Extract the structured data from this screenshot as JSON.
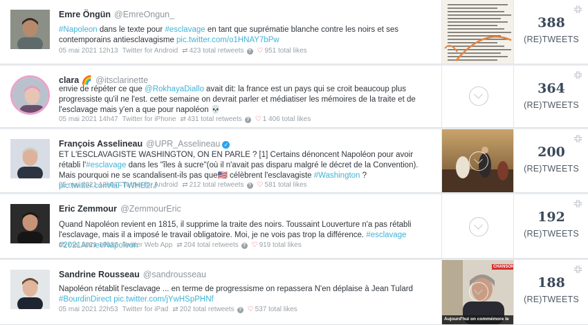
{
  "colors": {
    "link": "#3fb3d6",
    "heart": "#e0415a",
    "verified": "#2aa3ef"
  },
  "retweet_label": "(RE)TWEETS",
  "tweets": [
    {
      "name": "Emre Öngün",
      "handle": "@EmreOngun_",
      "body": [
        {
          "t": "#Napoleon",
          "h": true
        },
        {
          "t": " dans le texte pour ",
          "h": false
        },
        {
          "t": "#esclavage",
          "h": true
        },
        {
          "t": " en tant que suprématie blanche contre les noirs et ses contemporains antiesclavagisme ",
          "h": false
        },
        {
          "t": "pic.twitter.com/o1HNAY7bPw",
          "h": true
        }
      ],
      "date": "05 mai 2021 12h13",
      "source": "Twitter for Android",
      "retweets": "423 total retweets",
      "likes": "951 total likes",
      "count": "388",
      "media": "document-scan"
    },
    {
      "name": "clara 🌈",
      "handle": "@itsclarinette",
      "body": [
        {
          "t": "envie de répéter ce que ",
          "h": false
        },
        {
          "t": "@RokhayaDiallo",
          "h": true
        },
        {
          "t": " avait dit: la france est un pays qui se croit beaucoup plus progressiste qu'il ne l'est. cette semaine on devrait parler et médiatiser les mémoires de la traite et de l'esclavage mais y'en a que pour napoléon 💀",
          "h": false
        }
      ],
      "date": "05 mai 2021 14h47",
      "source": "Twitter for iPhone",
      "retweets": "431 total retweets",
      "likes": "1 406 total likes",
      "count": "364",
      "media": "none"
    },
    {
      "name": "François Asselineau",
      "handle": "@UPR_Asselineau",
      "verified": true,
      "body": [
        {
          "t": "ET L'ESCLAVAGISTE WASHINGTON, ON EN PARLE ? [1] Certains dénoncent Napoléon pour avoir rétabli l'",
          "h": false
        },
        {
          "t": "#esclavage",
          "h": true
        },
        {
          "t": " dans les \"îles à sucre\"(où il n'avait pas disparu malgré le décret de la Convention). Mais pourquoi ne se scandalisent-ils pas que🇺🇸 célèbrent l'esclavagiste ",
          "h": false
        },
        {
          "t": "#Washington",
          "h": true
        },
        {
          "t": " ? ",
          "h": false
        },
        {
          "t": "pic.twitter.com/laFTWHB2rJ",
          "h": true
        }
      ],
      "date": "05 mai 2021 12h07",
      "source": "Twitter for Android",
      "retweets": "212 total retweets",
      "likes": "581 total likes",
      "count": "200",
      "media": "painting"
    },
    {
      "name": "Eric Zemmour",
      "handle": "@ZemmourEric",
      "body": [
        {
          "t": "Quand Napoléon revient en 1815, il supprime la traite des noirs. Toussaint Louverture n'a pas rétabli l'esclavage, mais il a imposé le travail obligatoire. Moi, je ne vois pas trop la différence. ",
          "h": false
        },
        {
          "t": "#esclavage",
          "h": true
        },
        {
          "t": " ",
          "h": false
        },
        {
          "t": "#2021AnneeNapoleon",
          "h": true
        }
      ],
      "date": "05 mai 2021 19h37",
      "source": "Twitter Web App",
      "retweets": "204 total retweets",
      "likes": "919 total likes",
      "count": "192",
      "media": "none"
    },
    {
      "name": "Sandrine Rousseau",
      "handle": "@sandrousseau",
      "body": [
        {
          "t": "Napoléon rétablit l'esclavage ... en terme de progressisme on repassera N'en déplaise à Jean Tulard ",
          "h": false
        },
        {
          "t": "#BourdinDirect",
          "h": true
        },
        {
          "t": " ",
          "h": false
        },
        {
          "t": "pic.twitter.com/jYwHSpPHNf",
          "h": true
        }
      ],
      "date": "05 mai 2021 22h53",
      "source": "Twitter for iPad",
      "retweets": "202 total retweets",
      "likes": "537 total likes",
      "count": "188",
      "media": "video",
      "media_badge": "CHANSONT.",
      "media_caption": "Aujourd'hui on commémore le"
    }
  ]
}
